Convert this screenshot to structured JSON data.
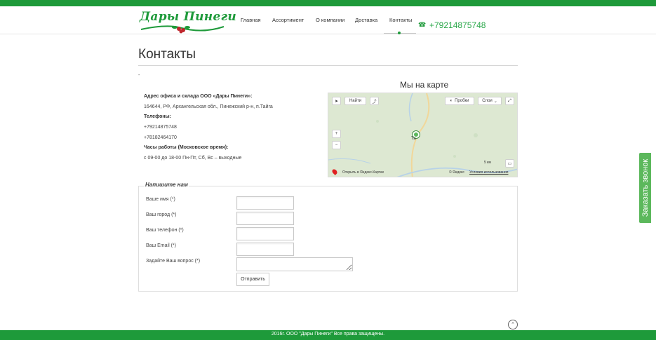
{
  "header": {
    "logo_text": "Дары Пинеги",
    "phone": "+79214875748",
    "nav": [
      {
        "label": "Главная"
      },
      {
        "label": "Ассортимент"
      },
      {
        "label": "О компании"
      },
      {
        "label": "Доставка"
      },
      {
        "label": "Контакты",
        "active": true
      }
    ]
  },
  "page": {
    "title": "Контакты",
    "dash": "-"
  },
  "contacts": {
    "address_label": "Адрес офиса и склада ООО «Дары Пинеги»:",
    "address": "164644, РФ, Архангельская обл., Пинежский р-н, п.Тайга",
    "phones_label": "Телефоны:",
    "phone1": "+79214875748",
    "phone2": "+78182464170",
    "hours_label": "Часы работы (Московское время):",
    "hours": "с 09-00 до 18-00 Пн-Пт, Сб, Вс – выходные"
  },
  "map": {
    "title": "Мы на карте",
    "find_label": "Найти",
    "traffic_label": "Пробки",
    "layers_label": "Слои",
    "scale_label": "5 км",
    "open_label": "Открыть в Яндекс.Картах",
    "copyright": "© Яндекс",
    "terms": "Условия использования",
    "place_label": "Та"
  },
  "form": {
    "legend": "Напишите нам",
    "fields": [
      {
        "label": "Ваше имя (*)"
      },
      {
        "label": "Ваш город (*)"
      },
      {
        "label": "Ваш телефон (*)"
      },
      {
        "label": "Ваш Email (*)"
      },
      {
        "label": "Задайте Ваш вопрос (*)"
      }
    ],
    "submit_label": "Отправить"
  },
  "footer": {
    "text": "2016г. ООО \"Дары Пинеги\" Все права защищены."
  },
  "callback": {
    "label": "Заказать звонок"
  },
  "colors": {
    "brand_green": "#1e9a3a",
    "phone_green": "#2aa84a",
    "callback_green": "#5cb85c"
  }
}
